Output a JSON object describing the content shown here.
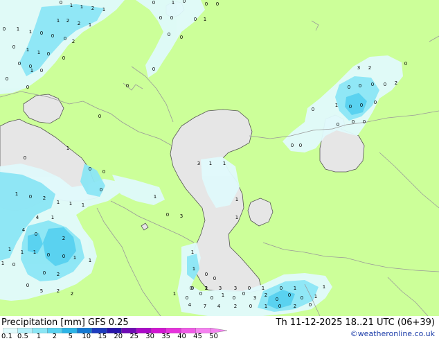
{
  "title": {
    "left": "Precipitation [mm] GFS 0.25",
    "right": "Th 11-12-2025 18..21 UTC (06+39)",
    "credit": "©weatheronline.co.uk"
  },
  "colors": {
    "land": "#ccff99",
    "water": "#e6e6e6",
    "border": "#999999",
    "coast": "#555555"
  },
  "legend": {
    "labels": [
      "0.1",
      "0.5",
      "1",
      "2",
      "5",
      "10",
      "15",
      "20",
      "25",
      "30",
      "35",
      "40",
      "45",
      "50"
    ],
    "colors": [
      "#e0fafc",
      "#b4f0fa",
      "#8be6f5",
      "#5ad2f0",
      "#2db4e6",
      "#1478d2",
      "#1e3cbe",
      "#2814aa",
      "#6e0ab4",
      "#aa0ac8",
      "#d214d2",
      "#e632dc",
      "#f05ae6",
      "#f582f0"
    ]
  },
  "map_labels": [
    {
      "t": "0"
    },
    {
      "t": "1"
    },
    {
      "t": "1"
    },
    {
      "t": "2"
    },
    {
      "t": "1"
    },
    {
      "t": "1"
    },
    {
      "t": "2"
    },
    {
      "t": "2"
    },
    {
      "t": "1"
    },
    {
      "t": "0"
    },
    {
      "t": "1"
    },
    {
      "t": "1"
    },
    {
      "t": "0"
    },
    {
      "t": "0"
    },
    {
      "t": "0"
    },
    {
      "t": "2"
    },
    {
      "t": "0"
    },
    {
      "t": "1"
    },
    {
      "t": "1"
    },
    {
      "t": "0"
    },
    {
      "t": "0"
    },
    {
      "t": "0"
    },
    {
      "t": "0"
    },
    {
      "t": "1"
    },
    {
      "t": "0"
    },
    {
      "t": "0"
    },
    {
      "t": "0"
    },
    {
      "t": "0"
    },
    {
      "t": "0"
    },
    {
      "t": "1"
    },
    {
      "t": "0"
    },
    {
      "t": "0"
    },
    {
      "t": "0"
    },
    {
      "t": "0"
    },
    {
      "t": "0"
    },
    {
      "t": "1"
    },
    {
      "t": "0"
    },
    {
      "t": "0"
    },
    {
      "t": "0"
    },
    {
      "t": "0"
    },
    {
      "t": "0"
    },
    {
      "t": "0"
    },
    {
      "t": "1"
    },
    {
      "t": "0"
    },
    {
      "t": "0"
    },
    {
      "t": "0"
    },
    {
      "t": "3"
    },
    {
      "t": "2"
    },
    {
      "t": "0"
    },
    {
      "t": "0"
    },
    {
      "t": "0"
    },
    {
      "t": "0"
    },
    {
      "t": "0"
    },
    {
      "t": "2"
    },
    {
      "t": "1"
    },
    {
      "t": "0"
    },
    {
      "t": "0"
    },
    {
      "t": "0"
    },
    {
      "t": "0"
    },
    {
      "t": "0"
    },
    {
      "t": "0"
    },
    {
      "t": "0"
    },
    {
      "t": "0"
    },
    {
      "t": "0"
    },
    {
      "t": "3"
    },
    {
      "t": "1"
    },
    {
      "t": "1"
    },
    {
      "t": "1"
    },
    {
      "t": "0"
    },
    {
      "t": "2"
    },
    {
      "t": "1"
    },
    {
      "t": "1"
    },
    {
      "t": "1"
    },
    {
      "t": "1"
    },
    {
      "t": "1"
    },
    {
      "t": "1"
    },
    {
      "t": "0"
    },
    {
      "t": "3"
    },
    {
      "t": "4"
    },
    {
      "t": "1"
    },
    {
      "t": "4"
    },
    {
      "t": "0"
    },
    {
      "t": "2"
    },
    {
      "t": "1"
    },
    {
      "t": "1"
    },
    {
      "t": "1"
    },
    {
      "t": "0"
    },
    {
      "t": "0"
    },
    {
      "t": "1"
    },
    {
      "t": "1"
    },
    {
      "t": "1"
    },
    {
      "t": "0"
    },
    {
      "t": "1"
    },
    {
      "t": "1"
    },
    {
      "t": "0"
    },
    {
      "t": "2"
    },
    {
      "t": "0"
    },
    {
      "t": "5"
    },
    {
      "t": "2"
    },
    {
      "t": "2"
    },
    {
      "t": "0"
    },
    {
      "t": "1"
    },
    {
      "t": "3"
    },
    {
      "t": "3"
    },
    {
      "t": "0"
    },
    {
      "t": "1"
    },
    {
      "t": "0"
    },
    {
      "t": "1"
    },
    {
      "t": "1"
    },
    {
      "t": "4"
    },
    {
      "t": "7"
    },
    {
      "t": "4"
    },
    {
      "t": "2"
    },
    {
      "t": "0"
    },
    {
      "t": "1"
    },
    {
      "t": "0"
    },
    {
      "t": "2"
    },
    {
      "t": "0"
    },
    {
      "t": "0"
    },
    {
      "t": "0"
    },
    {
      "t": "0"
    },
    {
      "t": "2"
    },
    {
      "t": "1"
    },
    {
      "t": "0"
    },
    {
      "t": "0"
    },
    {
      "t": "0"
    },
    {
      "t": "1"
    },
    {
      "t": "0"
    },
    {
      "t": "0"
    },
    {
      "t": "3"
    },
    {
      "t": "2"
    },
    {
      "t": "0"
    },
    {
      "t": "0"
    },
    {
      "t": "0"
    },
    {
      "t": "1"
    }
  ]
}
